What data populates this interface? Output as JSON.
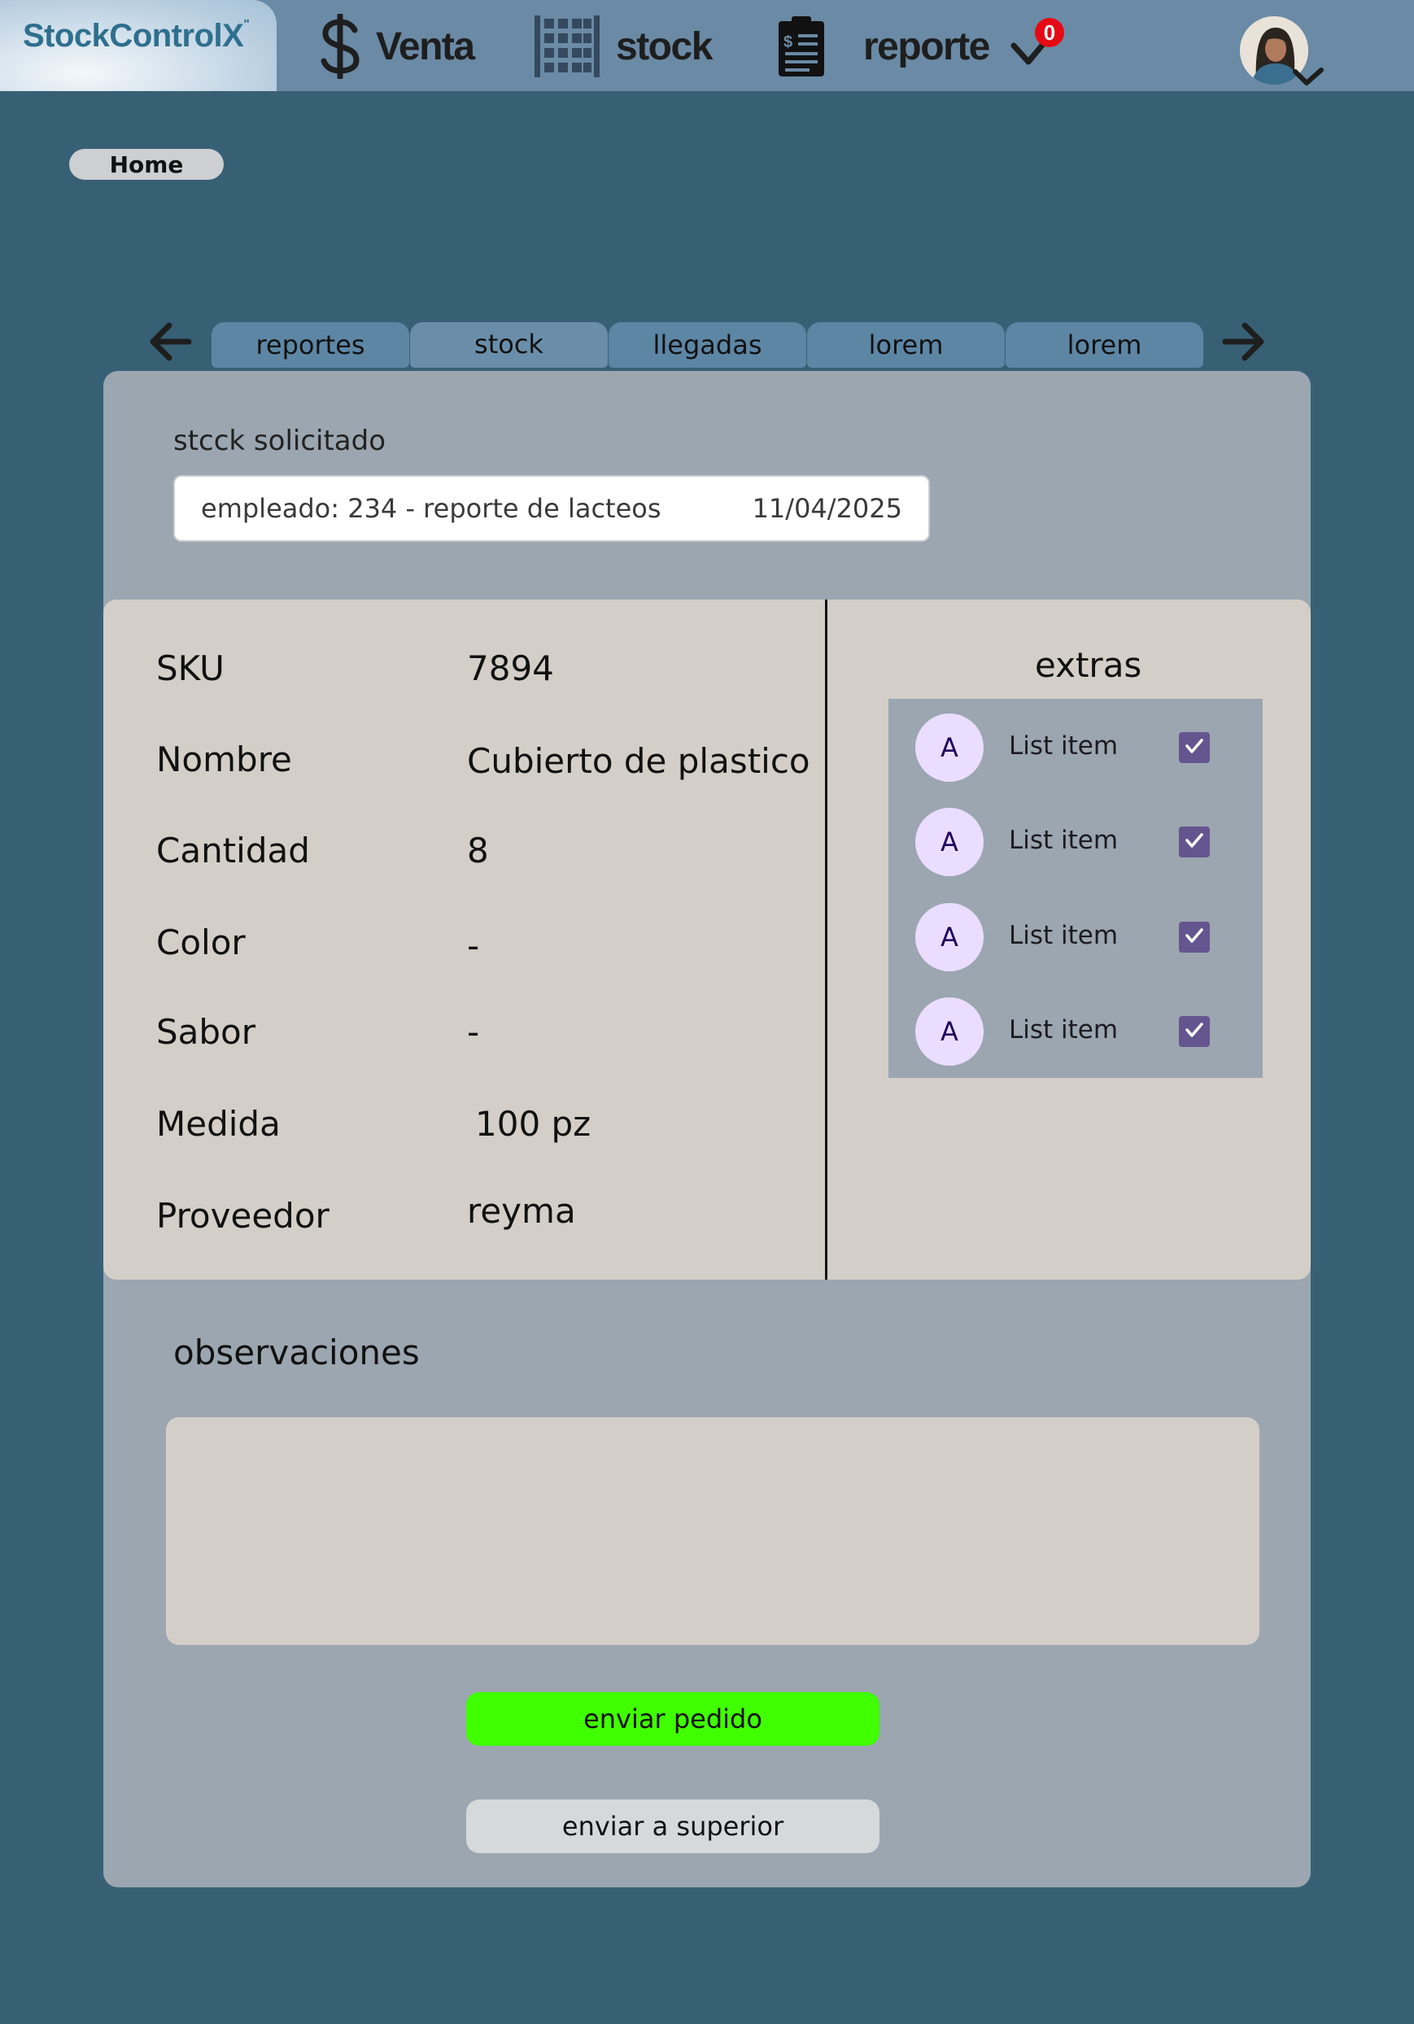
{
  "colors": {
    "page_bg": "#386075",
    "topbar_bg": "#6a8aa5",
    "logo_text": "#2f6f8e",
    "card_bg": "#9ba6b0",
    "panel_bg": "#d3cfc8",
    "primary_button": "#40ff00",
    "secondary_button": "#d6d9da",
    "checkbox": "#65558f",
    "badge": "#e50914"
  },
  "header": {
    "logo": {
      "text": "StockControlX",
      "mark": "\""
    },
    "nav": [
      {
        "label": "Venta",
        "icon": "dollar-icon"
      },
      {
        "label": "stock",
        "icon": "shelves-icon"
      },
      {
        "label": "reporte",
        "icon": "clipboard-report-icon"
      }
    ],
    "notification_count": "0",
    "profile_icon": "user-avatar"
  },
  "breadcrumb": {
    "label": "Home"
  },
  "tabs": [
    {
      "label": "reportes",
      "active": false
    },
    {
      "label": "stock",
      "active": true
    },
    {
      "label": "llegadas",
      "active": false
    },
    {
      "label": "lorem",
      "active": false
    },
    {
      "label": "lorem",
      "active": false
    }
  ],
  "request": {
    "label": "stcck solicitado",
    "value": "empleado: 234 - reporte de lacteos",
    "date": "11/04/2025"
  },
  "details": [
    {
      "label": "SKU",
      "value": "7894"
    },
    {
      "label": "Nombre",
      "value": "Cubierto de plastico"
    },
    {
      "label": "Cantidad",
      "value": "8"
    },
    {
      "label": "Color",
      "value": "-"
    },
    {
      "label": "Sabor",
      "value": "-"
    },
    {
      "label": "Medida",
      "value": "100 pz"
    },
    {
      "label": "Proveedor",
      "value": "reyma"
    }
  ],
  "extras": {
    "title": "extras",
    "items": [
      {
        "avatar": "A",
        "label": "List item",
        "checked": true
      },
      {
        "avatar": "A",
        "label": "List item",
        "checked": true
      },
      {
        "avatar": "A",
        "label": "List item",
        "checked": true
      },
      {
        "avatar": "A",
        "label": "List item",
        "checked": true
      }
    ]
  },
  "observations": {
    "label": "observaciones",
    "value": ""
  },
  "actions": {
    "send_order": "enviar pedido",
    "send_superior": "enviar a superior"
  }
}
